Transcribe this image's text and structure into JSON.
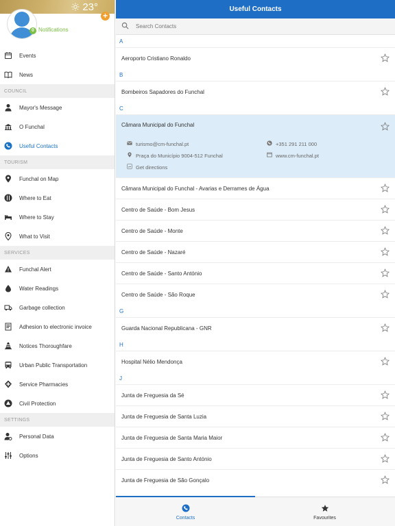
{
  "profile": {
    "temperature": "23°",
    "notification_count": "0",
    "notifications_label": "Notifications",
    "add_symbol": "+"
  },
  "sidebar": {
    "groups": [
      {
        "section": "",
        "items": [
          {
            "label": "Events",
            "icon": "calendar-icon"
          },
          {
            "label": "News",
            "icon": "newspaper-icon"
          }
        ]
      },
      {
        "section": "COUNCIL",
        "items": [
          {
            "label": "Mayor's Message",
            "icon": "person-icon"
          },
          {
            "label": "O Funchal",
            "icon": "building-icon"
          },
          {
            "label": "Useful Contacts",
            "icon": "phone-icon",
            "active": true
          }
        ]
      },
      {
        "section": "TOURISM",
        "items": [
          {
            "label": "Funchal on Map",
            "icon": "map-pin-icon"
          },
          {
            "label": "Where to Eat",
            "icon": "cutlery-icon"
          },
          {
            "label": "Where to Stay",
            "icon": "bed-icon"
          },
          {
            "label": "What to Visit",
            "icon": "location-icon"
          }
        ]
      },
      {
        "section": "SERVICES",
        "items": [
          {
            "label": "Funchal Alert",
            "icon": "alert-icon"
          },
          {
            "label": "Water Readings",
            "icon": "water-drop-icon"
          },
          {
            "label": "Garbage collection",
            "icon": "garbage-truck-icon"
          },
          {
            "label": "Adhesion to electronic invoice",
            "icon": "invoice-icon"
          },
          {
            "label": "Notices Thoroughfare",
            "icon": "traffic-cone-icon"
          },
          {
            "label": "Urban Public Transportation",
            "icon": "bus-icon"
          },
          {
            "label": "Service Pharmacies",
            "icon": "pharmacy-icon"
          },
          {
            "label": "Civil Protection",
            "icon": "civil-protection-icon"
          }
        ]
      },
      {
        "section": "SETTINGS",
        "items": [
          {
            "label": "Personal Data",
            "icon": "user-settings-icon"
          },
          {
            "label": "Options",
            "icon": "sliders-icon"
          }
        ]
      }
    ]
  },
  "header": {
    "title": "Useful Contacts"
  },
  "search": {
    "placeholder": "Search Contacts",
    "value": ""
  },
  "expanded_contact": {
    "name": "Câmara Municipal do Funchal",
    "email": "turismo@cm-funchal.pt",
    "phone": "+351 291 211 000",
    "address": "Praça do Município 9004-512 Funchal",
    "website": "www.cm-funchal.pt",
    "directions": "Get directions"
  },
  "contacts": {
    "groups": [
      {
        "letter": "A",
        "items": [
          "Aeroporto Cristiano Ronaldo"
        ]
      },
      {
        "letter": "B",
        "items": [
          "Bombeiros Sapadores do Funchal"
        ]
      },
      {
        "letter": "C",
        "items": [
          "Câmara Municipal do Funchal - Avarias e Derrames de Água",
          "Centro de Saúde - Bom Jesus",
          "Centro de Saúde - Monte",
          "Centro de Saúde - Nazaré",
          "Centro de Saúde - Santo António",
          "Centro de Saúde - São Roque"
        ]
      },
      {
        "letter": "G",
        "items": [
          "Guarda Nacional Republicana - GNR"
        ]
      },
      {
        "letter": "H",
        "items": [
          "Hospital Nélio Mendonça"
        ]
      },
      {
        "letter": "J",
        "items": [
          "Junta de Freguesia da Sé",
          "Junta de Freguesia de Santa Luzia",
          "Junta de Freguesia de Santa Maria Maior",
          "Junta de Freguesia de Santo António",
          "Junta de Freguesia de São Gonçalo"
        ]
      }
    ]
  },
  "tabs": {
    "contacts": "Contacts",
    "favourites": "Favourites"
  },
  "colors": {
    "accent": "#1d6ec4",
    "notification_green": "#7bc043",
    "add_orange": "#f0a030"
  }
}
